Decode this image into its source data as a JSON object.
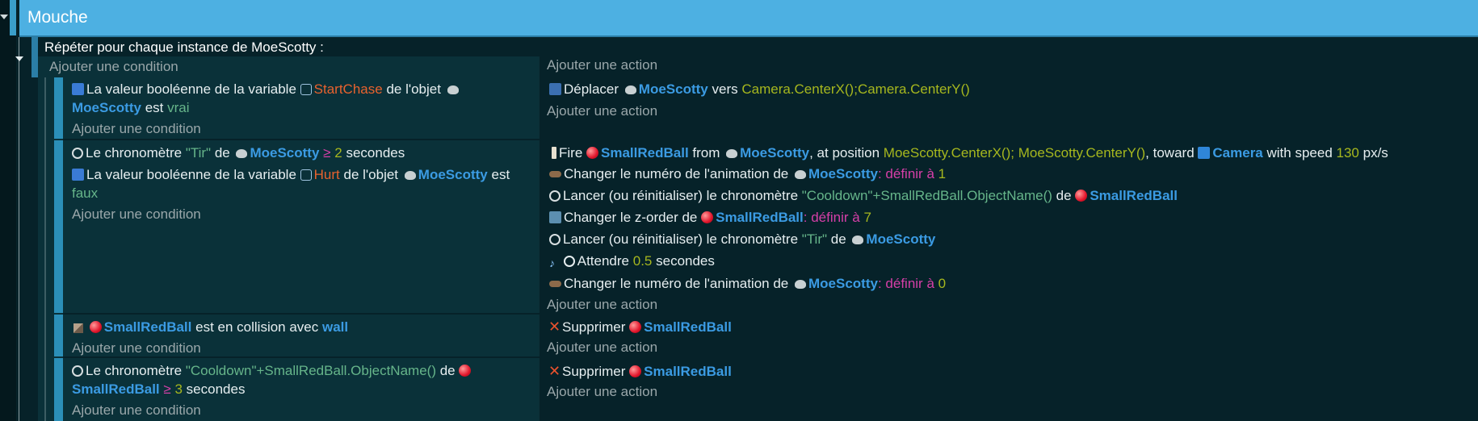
{
  "group": {
    "title": "Mouche"
  },
  "foreach": {
    "label": "Répéter pour chaque instance de MoeScotty :"
  },
  "add_condition": "Ajouter une condition",
  "add_action": "Ajouter une action",
  "colors": {
    "header_bg": "#4db0e2",
    "panel": "#0a3139",
    "object": "#3b9be3",
    "variable": "#e8622e",
    "string": "#66b58a",
    "number": "#a6b71e",
    "operator": "#d63fa8"
  },
  "e1": {
    "c1": {
      "a": "La valeur booléenne de la variable",
      "var": "StartChase",
      "b": "de l'objet",
      "obj": "MoeScotty",
      "c": "est",
      "val": "vrai"
    },
    "a1": {
      "a": "Déplacer",
      "obj": "MoeScotty",
      "b": "vers",
      "expr": "Camera.CenterX();Camera.CenterY()"
    }
  },
  "e2": {
    "c1": {
      "a": "Le chronomètre",
      "str": "\"Tir\"",
      "b": "de",
      "obj": "MoeScotty",
      "op": "≥",
      "num": "2",
      "c": "secondes"
    },
    "c2": {
      "a": "La valeur booléenne de la variable",
      "var": "Hurt",
      "b": "de l'objet",
      "obj": "MoeScotty",
      "c": "est",
      "val": "faux"
    },
    "a1": {
      "a": "Fire",
      "obj": "SmallRedBall",
      "b": "from",
      "obj2": "MoeScotty",
      "c": ", at position",
      "expr": "MoeScotty.CenterX(); MoeScotty.CenterY()",
      "d": ", toward",
      "obj3": "Camera",
      "e": "with speed",
      "num": "130",
      "f": "px/s"
    },
    "a2": {
      "a": "Changer le numéro de l'animation de",
      "obj": "MoeScotty",
      "op": ": définir à",
      "num": "1"
    },
    "a3": {
      "a": "Lancer (ou réinitialiser) le chronomètre",
      "str": "\"Cooldown\"+SmallRedBall.ObjectName()",
      "b": "de",
      "obj": "SmallRedBall"
    },
    "a4": {
      "a": "Changer le z-order de",
      "obj": "SmallRedBall",
      "op": ": définir à",
      "num": "7"
    },
    "a5": {
      "a": "Lancer (ou réinitialiser) le chronomètre",
      "str": "\"Tir\"",
      "b": "de",
      "obj": "MoeScotty"
    },
    "a6": {
      "a": "Attendre",
      "num": "0.5",
      "b": "secondes"
    },
    "a7": {
      "a": "Changer le numéro de l'animation de",
      "obj": "MoeScotty",
      "op": ": définir à",
      "num": "0"
    }
  },
  "e3": {
    "c1": {
      "obj": "SmallRedBall",
      "a": "est en collision avec",
      "obj2": "wall"
    },
    "a1": {
      "a": "Supprimer",
      "obj": "SmallRedBall"
    }
  },
  "e4": {
    "c1": {
      "a": "Le chronomètre",
      "str": "\"Cooldown\"+SmallRedBall.ObjectName()",
      "b": "de",
      "obj": "SmallRedBall",
      "op": "≥",
      "num": "3",
      "c": "secondes"
    },
    "a1": {
      "a": "Supprimer",
      "obj": "SmallRedBall"
    }
  }
}
